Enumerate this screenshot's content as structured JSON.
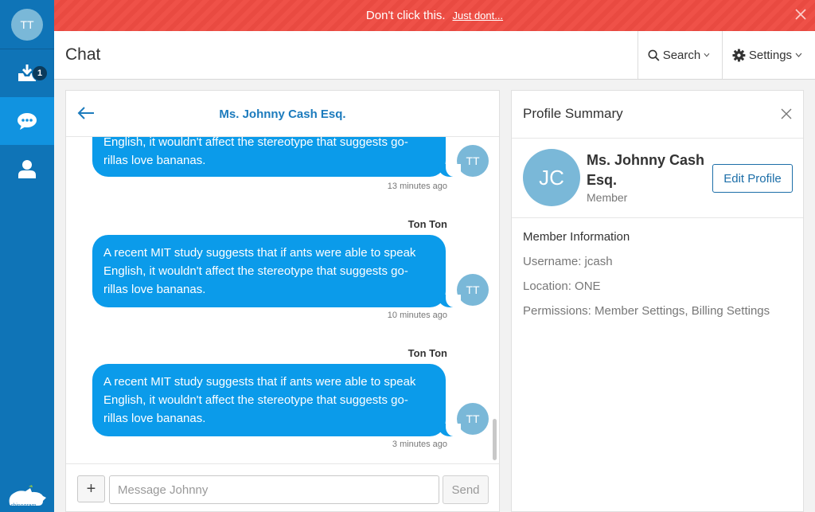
{
  "sidebar": {
    "user_initials": "TT",
    "inbox_badge": "1",
    "logo_text": "rhinogram"
  },
  "banner": {
    "text": "Don't click this.",
    "link": "Just dont..."
  },
  "header": {
    "title": "Chat",
    "search_label": "Search",
    "settings_label": "Settings"
  },
  "chat": {
    "contact_name": "Ms. Johnny Cash Esq.",
    "messages": [
      {
        "sender": "",
        "text_lines": [
          "English, it wouldn't affect the stereotype that suggests go-",
          "rillas love bananas."
        ],
        "time": "13 minutes ago",
        "avatar": "TT"
      },
      {
        "sender": "Ton Ton",
        "text_lines": [
          "A recent MIT study suggests that if ants were able to speak",
          "English, it wouldn't affect the stereotype that suggests go-",
          "rillas love bananas."
        ],
        "time": "10 minutes ago",
        "avatar": "TT"
      },
      {
        "sender": "Ton Ton",
        "text_lines": [
          "A recent MIT study suggests that if ants were able to speak",
          "English, it wouldn't affect the stereotype that suggests go-",
          "rillas love bananas."
        ],
        "time": "3 minutes ago",
        "avatar": "TT"
      }
    ],
    "input_placeholder": "Message Johnny",
    "plus_label": "+",
    "send_label": "Send"
  },
  "profile": {
    "title": "Profile Summary",
    "initials": "JC",
    "name": "Ms. Johnny Cash Esq.",
    "role": "Member",
    "edit_label": "Edit Profile",
    "info_title": "Member Information",
    "username": "Username: jcash",
    "location": "Location: ONE",
    "permissions": "Permissions: Member Settings, Billing Settings"
  },
  "colors": {
    "sidebar": "#0f74b7",
    "sidebar_active": "#1193e0",
    "banner": "#ef5148",
    "bubble": "#0b9bea",
    "avatar": "#7ab8d8",
    "link": "#1c7bbd"
  }
}
